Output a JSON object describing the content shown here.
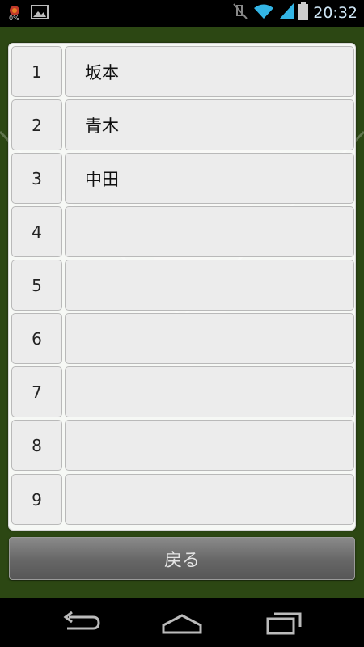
{
  "status_bar": {
    "time": "20:32",
    "battery_percent_label": "0%"
  },
  "lineup": {
    "rows": [
      {
        "number": "1",
        "name": "坂本"
      },
      {
        "number": "2",
        "name": "青木"
      },
      {
        "number": "3",
        "name": "中田"
      },
      {
        "number": "4",
        "name": ""
      },
      {
        "number": "5",
        "name": ""
      },
      {
        "number": "6",
        "name": ""
      },
      {
        "number": "7",
        "name": ""
      },
      {
        "number": "8",
        "name": ""
      },
      {
        "number": "9",
        "name": ""
      }
    ]
  },
  "back_button_label": "戻る",
  "colors": {
    "field_green": "#2c4713",
    "time_blue": "#cfe6f5",
    "signal_blue": "#33b5e5"
  }
}
